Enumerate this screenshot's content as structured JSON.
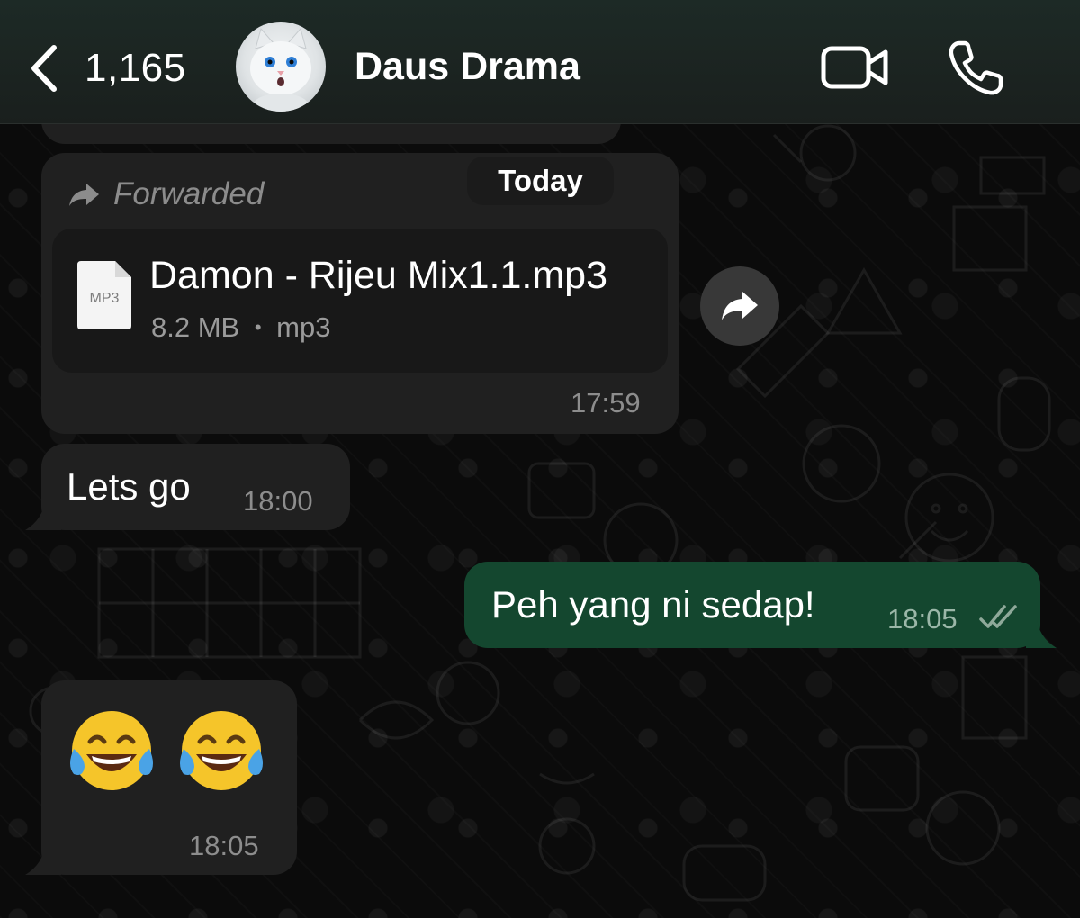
{
  "header": {
    "back_count": "1,165",
    "contact_name": "Daus Drama"
  },
  "messages": [
    {
      "direction": "incoming",
      "forwarded_label": "Forwarded",
      "attachment": {
        "name": "Damon - Rijeu Mix1.1.mp3",
        "type_badge": "MP3",
        "size": "8.2 MB",
        "separator": "•",
        "ext": "mp3"
      },
      "time": "17:59"
    },
    {
      "direction": "incoming",
      "text": "Lets go",
      "time": "18:00"
    },
    {
      "direction": "outgoing",
      "text": "Peh yang ni sedap!",
      "time": "18:05",
      "status": "read"
    },
    {
      "direction": "incoming",
      "emojis": [
        "face-with-tears-of-joy",
        "face-with-tears-of-joy"
      ],
      "time": "18:05"
    }
  ],
  "date_separator": "Today",
  "colors": {
    "background": "#0b0b0b",
    "incoming_bubble": "#202020",
    "outgoing_bubble": "#14472f",
    "meta_text": "#8d8d8d",
    "read_ticks": "#8fa99a"
  }
}
